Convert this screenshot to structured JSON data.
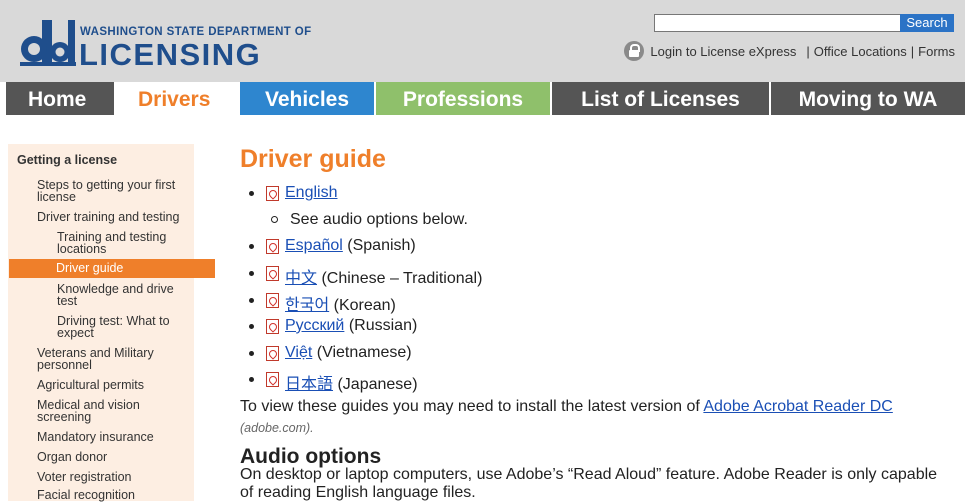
{
  "header": {
    "logo_line1": "WASHINGTON STATE DEPARTMENT OF",
    "logo_line2": "LICENSING",
    "search_placeholder": "",
    "search_button": "Search",
    "login": "Login to License eXpress",
    "sep1": "|",
    "office": "Office Locations",
    "sep2": "|",
    "forms": "Forms"
  },
  "nav": {
    "home": "Home",
    "drivers": "Drivers",
    "vehicles": "Vehicles",
    "professions": "Professions",
    "list": "List of Licenses",
    "moving": "Moving to WA"
  },
  "sidebar": {
    "items": [
      {
        "label": "Getting a license"
      },
      {
        "label": "Steps to getting your first"
      },
      {
        "label": "license"
      },
      {
        "label": "Driver training and testing"
      },
      {
        "label": "Training and testing"
      },
      {
        "label": "locations"
      },
      {
        "label": "Driver guide"
      },
      {
        "label": "Knowledge and drive"
      },
      {
        "label": "test"
      },
      {
        "label": "Driving test: What to"
      },
      {
        "label": "expect"
      },
      {
        "label": "Veterans and Military"
      },
      {
        "label": "personnel"
      },
      {
        "label": "Agricultural permits"
      },
      {
        "label": "Medical and vision"
      },
      {
        "label": "screening"
      },
      {
        "label": "Mandatory insurance"
      },
      {
        "label": "Organ donor"
      },
      {
        "label": "Voter registration"
      },
      {
        "label": "Facial recognition"
      }
    ]
  },
  "main": {
    "title": "Driver guide",
    "languages": [
      {
        "link": "English",
        "note": ""
      },
      {
        "link": "Español",
        "note": "(Spanish)"
      },
      {
        "link": "中文",
        "note": "(Chinese – Traditional)"
      },
      {
        "link": "한국어",
        "note": "(Korean)"
      },
      {
        "link": "Русский",
        "note": "(Russian)"
      },
      {
        "link": "Việt",
        "note": "(Vietnamese)"
      },
      {
        "link": "日本語",
        "note": "(Japanese)"
      }
    ],
    "english_sub": "See audio options below.",
    "install_text": "To view these guides you may need to install the latest version of",
    "install_link": "Adobe Acrobat Reader DC",
    "install_source": "(adobe.com).",
    "audio_heading": "Audio options",
    "audio_line1": "On desktop or laptop computers, use Adobe’s “Read Aloud” feature. Adobe Reader is only capable",
    "audio_line2": "of reading English language files."
  },
  "colors": {
    "accent_orange": "#ef7f2a",
    "brand_blue": "#1f4e8c",
    "vehicles_blue": "#2e86cf",
    "professions_green": "#8fc06b",
    "nav_gray": "#555555",
    "sidebar_bg": "#fdeee2"
  }
}
